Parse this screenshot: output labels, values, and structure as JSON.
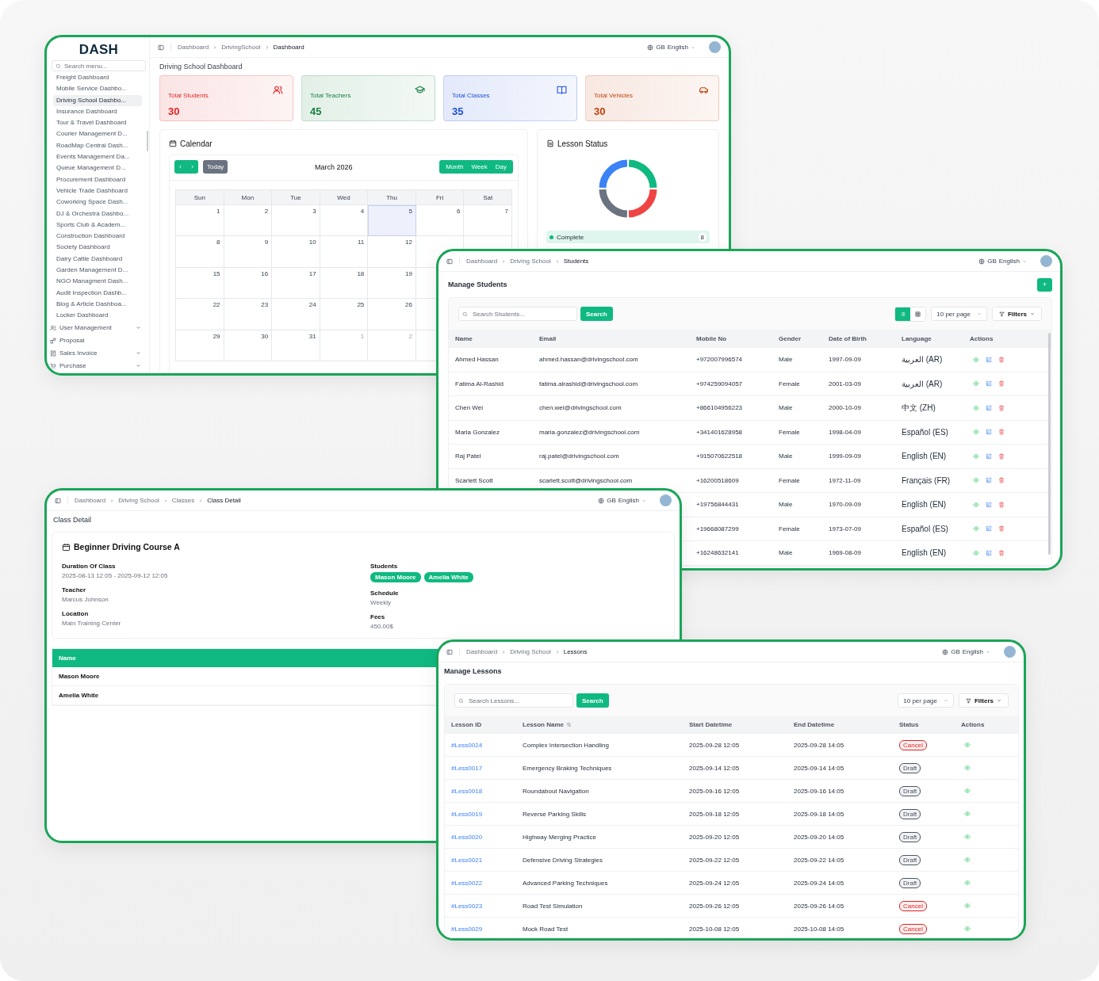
{
  "dashboard": {
    "logo": "DASH",
    "search": {
      "placeholder": "Search menu..."
    },
    "menu": [
      {
        "label": "Freight Dashboard",
        "selected": false
      },
      {
        "label": "Mobile Service Dashbo...",
        "selected": false
      },
      {
        "label": "Driving School Dashbo...",
        "selected": true
      },
      {
        "label": "Insurance Dashboard",
        "selected": false
      },
      {
        "label": "Tour & Travel Dashboard",
        "selected": false
      },
      {
        "label": "Courier Management D...",
        "selected": false
      },
      {
        "label": "RoadMap Central Dash...",
        "selected": false
      },
      {
        "label": "Events Management Da...",
        "selected": false
      },
      {
        "label": "Queue Management D...",
        "selected": false
      },
      {
        "label": "Procurement Dashboard",
        "selected": false
      },
      {
        "label": "Vehicle Trade Dashboard",
        "selected": false
      },
      {
        "label": "Coworking Space Dash...",
        "selected": false
      },
      {
        "label": "DJ & Orchestra Dashbo...",
        "selected": false
      },
      {
        "label": "Sports Club & Academ...",
        "selected": false
      },
      {
        "label": "Construction Dashboard",
        "selected": false
      },
      {
        "label": "Society Dashboard",
        "selected": false
      },
      {
        "label": "Dairy Cattle Dashboard",
        "selected": false
      },
      {
        "label": "Garden Management D...",
        "selected": false
      },
      {
        "label": "NGO Managment Dash...",
        "selected": false
      },
      {
        "label": "Audit Inspection Dashb...",
        "selected": false
      },
      {
        "label": "Blog & Article Dashboa...",
        "selected": false
      },
      {
        "label": "Locker Dashboard",
        "selected": false
      }
    ],
    "groups": [
      {
        "label": "User Management",
        "kind": "dropdown"
      },
      {
        "label": "Proposal",
        "kind": "link"
      },
      {
        "label": "Sales Invoice",
        "kind": "dropdown"
      },
      {
        "label": "Purchase",
        "kind": "dropdown"
      }
    ],
    "breadcrumbs": [
      {
        "label": "Dashboard",
        "current": false
      },
      {
        "label": "DrivingSchool",
        "current": false
      },
      {
        "label": "Dashboard",
        "current": true
      }
    ],
    "language": {
      "flag": "GB",
      "label": "English"
    },
    "title": "Driving School Dashboard",
    "stats": [
      {
        "label": "Total Students",
        "value": "30",
        "color": "#dc2626"
      },
      {
        "label": "Total Teachers",
        "value": "45",
        "color": "#15803d"
      },
      {
        "label": "Total Classes",
        "value": "35",
        "color": "#1d4ed8"
      },
      {
        "label": "Total Vehicles",
        "value": "30",
        "color": "#c2410c"
      }
    ],
    "calendar": {
      "title": "Calendar",
      "today_button": "Today",
      "month": "March 2026",
      "views": [
        "Month",
        "Week",
        "Day"
      ],
      "weekdays": [
        "Sun",
        "Mon",
        "Tue",
        "Wed",
        "Thu",
        "Fri",
        "Sat"
      ],
      "weeks": [
        [
          {
            "day": "1",
            "muted": false,
            "today": false
          },
          {
            "day": "2",
            "muted": false,
            "today": false
          },
          {
            "day": "3",
            "muted": false,
            "today": false
          },
          {
            "day": "4",
            "muted": false,
            "today": false
          },
          {
            "day": "5",
            "muted": false,
            "today": true
          },
          {
            "day": "6",
            "muted": false,
            "today": false
          },
          {
            "day": "7",
            "muted": false,
            "today": false
          }
        ],
        [
          {
            "day": "8",
            "muted": false,
            "today": false
          },
          {
            "day": "9",
            "muted": false,
            "today": false
          },
          {
            "day": "10",
            "muted": false,
            "today": false
          },
          {
            "day": "11",
            "muted": false,
            "today": false
          },
          {
            "day": "12",
            "muted": false,
            "today": false
          }
        ],
        [
          {
            "day": "15",
            "muted": false,
            "today": false
          },
          {
            "day": "16",
            "muted": false,
            "today": false
          },
          {
            "day": "17",
            "muted": false,
            "today": false
          },
          {
            "day": "18",
            "muted": false,
            "today": false
          },
          {
            "day": "19",
            "muted": false,
            "today": false
          }
        ],
        [
          {
            "day": "22",
            "muted": false,
            "today": false
          },
          {
            "day": "23",
            "muted": false,
            "today": false
          },
          {
            "day": "24",
            "muted": false,
            "today": false
          },
          {
            "day": "25",
            "muted": false,
            "today": false
          },
          {
            "day": "26",
            "muted": false,
            "today": false
          }
        ],
        [
          {
            "day": "29",
            "muted": false,
            "today": false
          },
          {
            "day": "30",
            "muted": false,
            "today": false
          },
          {
            "day": "31",
            "muted": false,
            "today": false
          },
          {
            "day": "1",
            "muted": true,
            "today": false
          },
          {
            "day": "2",
            "muted": true,
            "today": false
          }
        ]
      ]
    },
    "lesson_status": {
      "title": "Lesson Status",
      "legend": [
        {
          "label": "Complete",
          "count": "8",
          "color": "#10b981"
        }
      ]
    }
  },
  "students": {
    "breadcrumbs": [
      {
        "label": "Dashboard",
        "current": false
      },
      {
        "label": "Driving School",
        "current": false
      },
      {
        "label": "Students",
        "current": true
      }
    ],
    "language": {
      "flag": "GB",
      "label": "English"
    },
    "title": "Manage Students",
    "add_button": "+",
    "search": {
      "placeholder": "Search Students...",
      "button": "Search"
    },
    "view_toggle": [
      {
        "selected": true
      },
      {
        "selected": false
      }
    ],
    "per_page": "10 per page",
    "filters": "Filters",
    "columns": [
      "Name",
      "Email",
      "Mobile No",
      "Gender",
      "Date of Birth",
      "Language",
      "Actions"
    ],
    "rows": [
      {
        "name": "Ahmed Hassan",
        "email": "ahmed.hassan@drivingschool.com",
        "mobile": "+972007996574",
        "gender": "Male",
        "dob": "1997-09-09",
        "language": "العربية (AR)"
      },
      {
        "name": "Fatima Al-Rashid",
        "email": "fatima.alrashid@drivingschool.com",
        "mobile": "+974259094057",
        "gender": "Female",
        "dob": "2001-03-09",
        "language": "العربية (AR)"
      },
      {
        "name": "Chen Wei",
        "email": "chen.wei@drivingschool.com",
        "mobile": "+866104956223",
        "gender": "Male",
        "dob": "2000-10-09",
        "language": "中文 (ZH)"
      },
      {
        "name": "Maria Gonzalez",
        "email": "maria.gonzalez@drivingschool.com",
        "mobile": "+341401628958",
        "gender": "Female",
        "dob": "1998-04-09",
        "language": "Español (ES)"
      },
      {
        "name": "Raj Patel",
        "email": "raj.patel@drivingschool.com",
        "mobile": "+915070622518",
        "gender": "Male",
        "dob": "1999-09-09",
        "language": "English (EN)"
      },
      {
        "name": "Scarlett Scott",
        "email": "scarlett.scott@drivingschool.com",
        "mobile": "+16200518609",
        "gender": "Female",
        "dob": "1972-11-09",
        "language": "Français (FR)"
      },
      {
        "mobile": "+19756844431",
        "gender": "Male",
        "dob": "1970-09-09",
        "language": "English (EN)"
      },
      {
        "mobile": "+19668087299",
        "gender": "Female",
        "dob": "1973-07-09",
        "language": "Español (ES)"
      },
      {
        "mobile": "+16248632141",
        "gender": "Male",
        "dob": "1969-08-09",
        "language": "English (EN)"
      }
    ]
  },
  "class_detail": {
    "breadcrumbs": [
      {
        "label": "Dashboard",
        "current": false
      },
      {
        "label": "Driving School",
        "current": false
      },
      {
        "label": "Classes",
        "current": false
      },
      {
        "label": "Class Detail",
        "current": true
      }
    ],
    "language": {
      "flag": "GB",
      "label": "English"
    },
    "title": "Class Detail",
    "course": "Beginner Driving Course A",
    "fields_left": [
      {
        "label": "Duration Of Class",
        "value": "2025-08-13 12:05 - 2025-09-12 12:05"
      },
      {
        "label": "Teacher",
        "value": "Marcus Johnson"
      },
      {
        "label": "Location",
        "value": "Main Training Center"
      }
    ],
    "students_label": "Students",
    "students": [
      "Mason Moore",
      "Amelia White"
    ],
    "fields_right": [
      {
        "label": "Schedule",
        "value": "Weekly"
      },
      {
        "label": "Fees",
        "value": "450.00$"
      }
    ],
    "table": {
      "column": "Name",
      "rows": [
        "Mason Moore",
        "Amelia White"
      ]
    }
  },
  "lessons": {
    "breadcrumbs": [
      {
        "label": "Dashboard",
        "current": false
      },
      {
        "label": "Driving School",
        "current": false
      },
      {
        "label": "Lessons",
        "current": true
      }
    ],
    "language": {
      "flag": "GB",
      "label": "English"
    },
    "title": "Manage Lessons",
    "search": {
      "placeholder": "Search Lessons...",
      "button": "Search"
    },
    "per_page": "10 per page",
    "filters": "Filters",
    "columns": [
      "Lesson ID",
      "Lesson Name",
      "Start Datetime",
      "End Datetime",
      "Status",
      "Actions"
    ],
    "rows": [
      {
        "id": "#Less0024",
        "name": "Complex Intersection Handling",
        "start": "2025-09-28 12:05",
        "end": "2025-09-28 14:05",
        "status": {
          "label": "Cancel",
          "color": "#dc2626"
        }
      },
      {
        "id": "#Less0017",
        "name": "Emergency Braking Techniques",
        "start": "2025-09-14 12:05",
        "end": "2025-09-14 14:05",
        "status": {
          "label": "Draft",
          "color": "#4b5563"
        }
      },
      {
        "id": "#Less0018",
        "name": "Roundabout Navigation",
        "start": "2025-09-16 12:05",
        "end": "2025-09-16 14:05",
        "status": {
          "label": "Draft",
          "color": "#4b5563"
        }
      },
      {
        "id": "#Less0019",
        "name": "Reverse Parking Skills",
        "start": "2025-09-18 12:05",
        "end": "2025-09-18 14:05",
        "status": {
          "label": "Draft",
          "color": "#4b5563"
        }
      },
      {
        "id": "#Less0020",
        "name": "Highway Merging Practice",
        "start": "2025-09-20 12:05",
        "end": "2025-09-20 14:05",
        "status": {
          "label": "Draft",
          "color": "#4b5563"
        }
      },
      {
        "id": "#Less0021",
        "name": "Defensive Driving Strategies",
        "start": "2025-09-22 12:05",
        "end": "2025-09-22 14:05",
        "status": {
          "label": "Draft",
          "color": "#4b5563"
        }
      },
      {
        "id": "#Less0022",
        "name": "Advanced Parking Techniques",
        "start": "2025-09-24 12:05",
        "end": "2025-09-24 14:05",
        "status": {
          "label": "Draft",
          "color": "#4b5563"
        }
      },
      {
        "id": "#Less0023",
        "name": "Road Test Simulation",
        "start": "2025-09-26 12:05",
        "end": "2025-09-26 14:05",
        "status": {
          "label": "Cancel",
          "color": "#dc2626"
        }
      },
      {
        "id": "#Less0029",
        "name": "Mock Road Test",
        "start": "2025-10-08 12:05",
        "end": "2025-10-08 14:05",
        "status": {
          "label": "Cancel",
          "color": "#dc2626"
        }
      }
    ]
  }
}
